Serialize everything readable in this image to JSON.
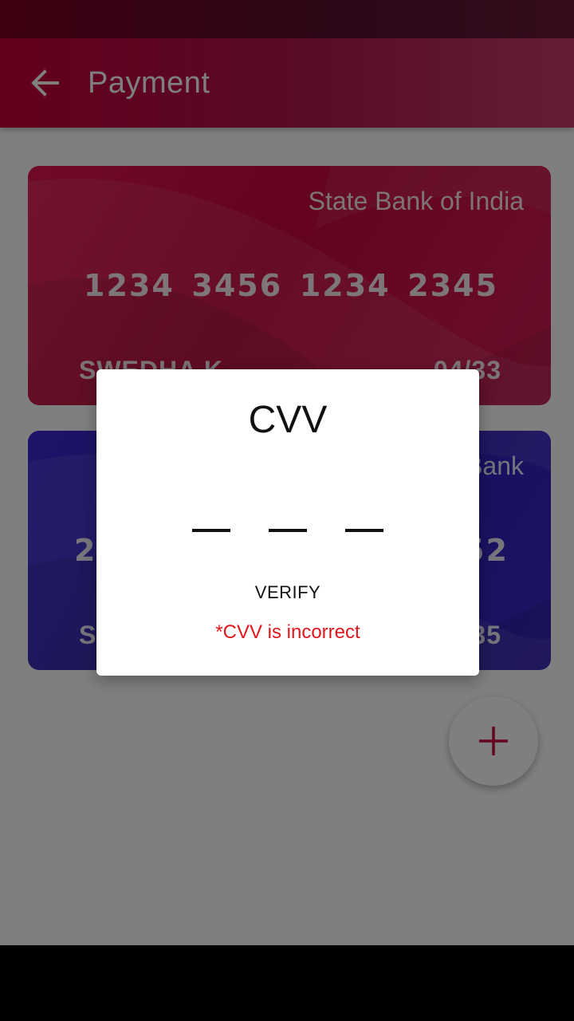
{
  "app_bar": {
    "title": "Payment",
    "back_icon": "arrow-back-icon"
  },
  "cards": [
    {
      "bank": "State Bank of India",
      "number_groups": [
        "1234",
        "3456",
        "1234",
        "2345"
      ],
      "holder": "SWEDHA K",
      "expiry": "04/33",
      "color": "#d1144c"
    },
    {
      "bank": "Bank",
      "number_groups": [
        "25",
        "",
        "",
        "52"
      ],
      "holder": "SV",
      "expiry": "35",
      "color": "#3a27c9"
    }
  ],
  "fab": {
    "icon": "plus-icon",
    "color": "#c8083c"
  },
  "dialog": {
    "title": "CVV",
    "verify_label": "VERIFY",
    "error": "*CVV is incorrect",
    "error_color": "#e0171c"
  }
}
